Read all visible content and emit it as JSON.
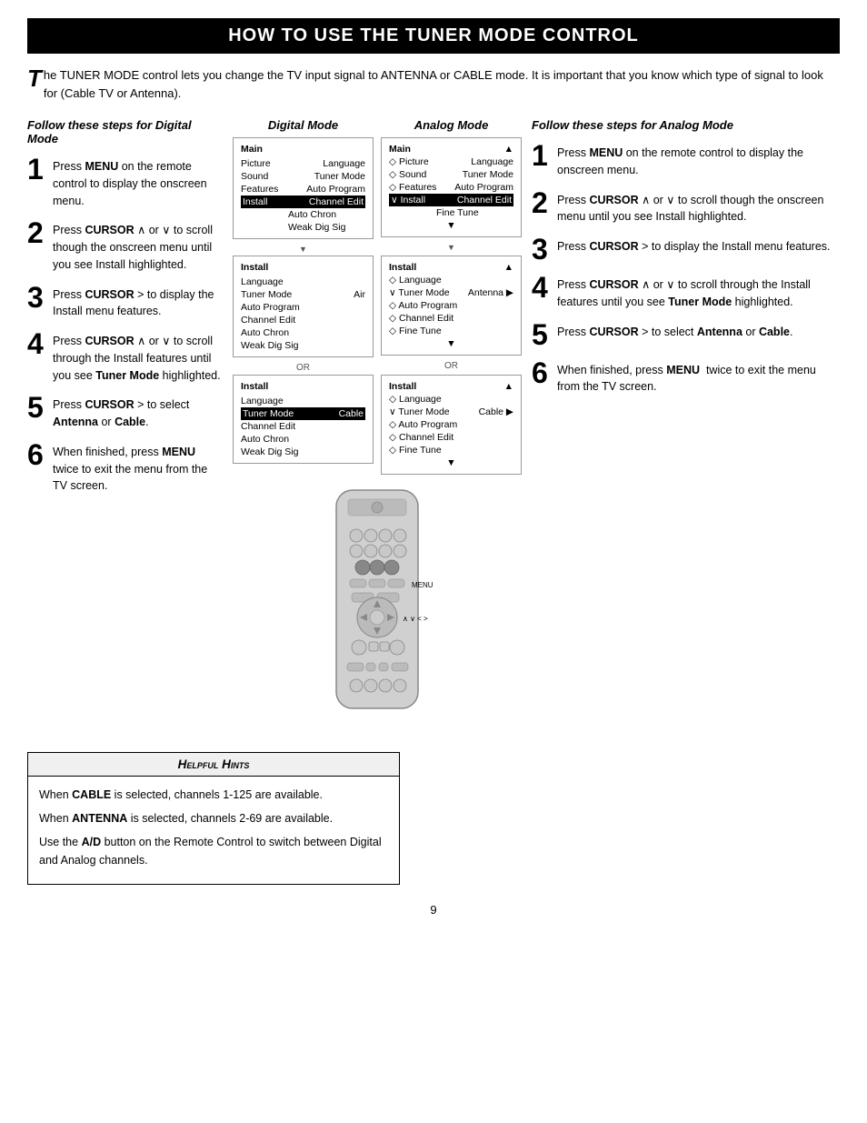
{
  "title": "HOW TO USE THE TUNER MODE CONTROL",
  "intro": {
    "drop_cap": "T",
    "text": "he TUNER MODE control lets you change the TV input signal to ANTENNA or CABLE mode. It is important that you know which type of signal to look for (Cable TV or Antenna)."
  },
  "digital_section": {
    "heading": "Follow these steps for Digital Mode",
    "steps": [
      {
        "num": "1",
        "text": "Press MENU on the remote control to display the onscreen menu."
      },
      {
        "num": "2",
        "text": "Press CURSOR ∧ or ∨ to scroll though the onscreen menu until you see Install highlighted."
      },
      {
        "num": "3",
        "text": "Press CURSOR > to display the Install menu features."
      },
      {
        "num": "4",
        "text": "Press CURSOR ∧ or ∨ to scroll through the Install features until you see Tuner Mode highlighted."
      },
      {
        "num": "5",
        "text": "Press CURSOR > to select Antenna or Cable."
      },
      {
        "num": "6",
        "text": "When finished, press MENU  twice to exit the menu from the TV screen."
      }
    ]
  },
  "analog_section": {
    "heading": "Follow these steps for Analog Mode",
    "steps": [
      {
        "num": "1",
        "text": "Press MENU on the remote control to display the onscreen menu."
      },
      {
        "num": "2",
        "text": "Press CURSOR ∧ or ∨ to scroll though the onscreen menu until you see Install highlighted."
      },
      {
        "num": "3",
        "text": "Press CURSOR > to display the Install menu features."
      },
      {
        "num": "4",
        "text": "Press CURSOR ∧ or ∨ to scroll through the Install features until you see Tuner Mode highlighted."
      },
      {
        "num": "5",
        "text": "Press CURSOR > to select Antenna or Cable."
      },
      {
        "num": "6",
        "text": "When finished, press MENU  twice to exit the menu from the TV screen."
      }
    ]
  },
  "digital_mode_label": "Digital Mode",
  "analog_mode_label": "Analog Mode",
  "screens": {
    "digital": {
      "screen1": {
        "title": "Main",
        "rows": [
          {
            "left": "Picture",
            "right": "Language"
          },
          {
            "left": "Sound",
            "right": "Tuner Mode"
          },
          {
            "left": "Features",
            "right": "Auto Program"
          },
          {
            "left": "Install",
            "right": "Channel Edit",
            "highlight": true
          },
          {
            "left": "",
            "right": "Auto Chron"
          },
          {
            "left": "",
            "right": "Weak Dig Sig"
          }
        ],
        "arrow": true
      },
      "screen2": {
        "title": "Install",
        "rows": [
          {
            "left": "Language",
            "right": ""
          },
          {
            "left": "Tuner Mode",
            "right": "Air"
          },
          {
            "left": "Auto Program",
            "right": ""
          },
          {
            "left": "Channel Edit",
            "right": ""
          },
          {
            "left": "Auto Chron",
            "right": ""
          },
          {
            "left": "Weak Dig Sig",
            "right": ""
          }
        ],
        "arrow": true
      },
      "screen3": {
        "title": "Install",
        "rows": [
          {
            "left": "Language",
            "right": ""
          },
          {
            "left": "Tuner Mode",
            "right": "Cable",
            "highlight": true
          },
          {
            "left": "Channel Edit",
            "right": ""
          },
          {
            "left": "Auto Chron",
            "right": ""
          },
          {
            "left": "Weak Dig Sig",
            "right": ""
          }
        ]
      }
    },
    "analog": {
      "screen1": {
        "title": "Main",
        "rows": [
          {
            "left": "◇ Picture",
            "right": "Language"
          },
          {
            "left": "◇ Sound",
            "right": "Tuner Mode"
          },
          {
            "left": "◇ Features",
            "right": "Auto Program"
          },
          {
            "left": "∨ Install",
            "right": "Channel Edit",
            "highlight": true
          },
          {
            "left": "",
            "right": "Fine Tune"
          }
        ],
        "arrow": true
      },
      "screen2": {
        "title": "Install",
        "rows": [
          {
            "left": "◇ Language",
            "right": ""
          },
          {
            "left": "∨ Tuner Mode",
            "right": "Antenna ▶",
            "highlight": false
          },
          {
            "left": "◇ Auto Program",
            "right": ""
          },
          {
            "left": "◇ Channel Edit",
            "right": ""
          },
          {
            "left": "◇ Fine Tune",
            "right": ""
          }
        ],
        "arrow": true
      },
      "screen3": {
        "title": "Install",
        "rows": [
          {
            "left": "◇ Language",
            "right": ""
          },
          {
            "left": "∨ Tuner Mode",
            "right": "Cable ▶",
            "highlight": false
          },
          {
            "left": "◇ Auto Program",
            "right": ""
          },
          {
            "left": "◇ Channel Edit",
            "right": ""
          },
          {
            "left": "◇ Fine Tune",
            "right": ""
          }
        ]
      }
    }
  },
  "menu_label": "MENU",
  "cursor_label": "∧ ∨ < >",
  "helpful_hints": {
    "title": "Helpful Hints",
    "hints": [
      "When CABLE is selected, channels 1-125 are available.",
      "When ANTENNA is selected, channels 2-69 are available.",
      "Use the A/D button on the Remote Control to switch between Digital and Analog channels."
    ]
  },
  "page_number": "9"
}
